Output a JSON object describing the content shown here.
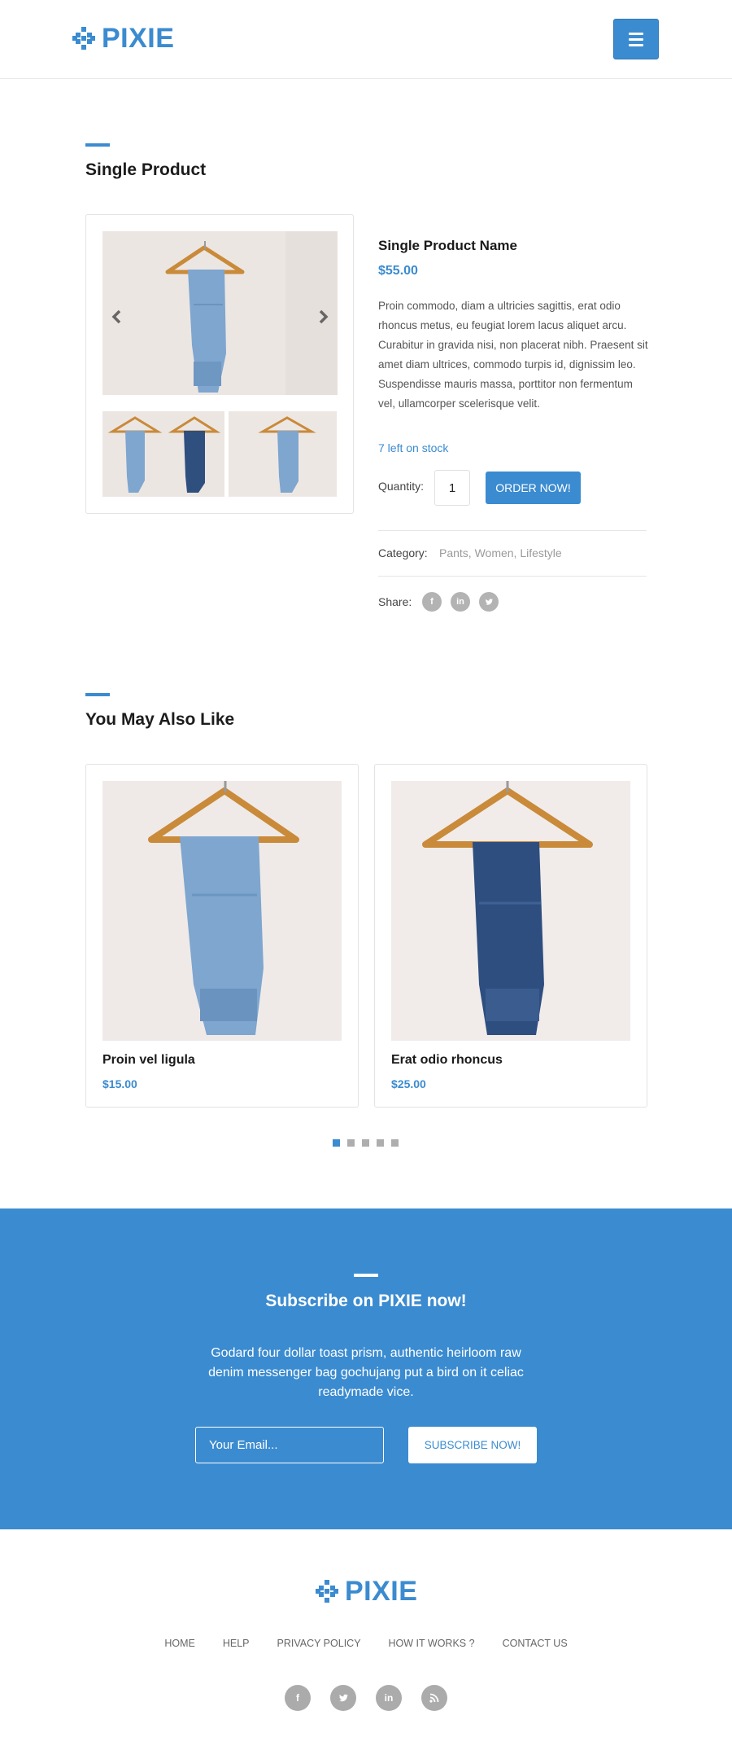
{
  "brand": {
    "name": "PIXIE",
    "color": "#3b8bd0"
  },
  "header": {
    "menu_icon": "hamburger-icon"
  },
  "product_section": {
    "title": "Single Product",
    "product": {
      "name": "Single Product Name",
      "price": "$55.00",
      "description": "Proin commodo, diam a ultricies sagittis, erat odio rhoncus metus, eu feugiat lorem lacus aliquet arcu. Curabitur in gravida nisi, non placerat nibh. Praesent sit amet diam ultrices, commodo turpis id, dignissim leo. Suspendisse mauris massa, porttitor non fermentum vel, ullamcorper scelerisque velit.",
      "stock": "7 left on stock",
      "quantity_label": "Quantity:",
      "quantity_value": "1",
      "order_button": "ORDER NOW!",
      "category_label": "Category:",
      "categories": "Pants, Women, Lifestyle",
      "share_label": "Share:",
      "share_icons": [
        "facebook-icon",
        "linkedin-icon",
        "twitter-icon"
      ]
    },
    "gallery": {
      "prev_icon": "chevron-left-icon",
      "next_icon": "chevron-right-icon"
    }
  },
  "related_section": {
    "title": "You May Also Like",
    "items": [
      {
        "name": "Proin vel ligula",
        "price": "$15.00"
      },
      {
        "name": "Erat odio rhoncus",
        "price": "$25.00"
      }
    ],
    "pagination": {
      "total": 5,
      "active": 1
    }
  },
  "subscribe": {
    "title": "Subscribe on PIXIE now!",
    "text": "Godard four dollar toast prism, authentic heirloom raw denim messenger bag gochujang put a bird on it celiac readymade vice.",
    "email_placeholder": "Your Email...",
    "button": "SUBSCRIBE NOW!"
  },
  "footer": {
    "nav": [
      "HOME",
      "HELP",
      "PRIVACY POLICY",
      "HOW IT WORKS ?",
      "CONTACT US"
    ],
    "social_icons": [
      "facebook-icon",
      "twitter-icon",
      "linkedin-icon",
      "rss-icon"
    ]
  }
}
